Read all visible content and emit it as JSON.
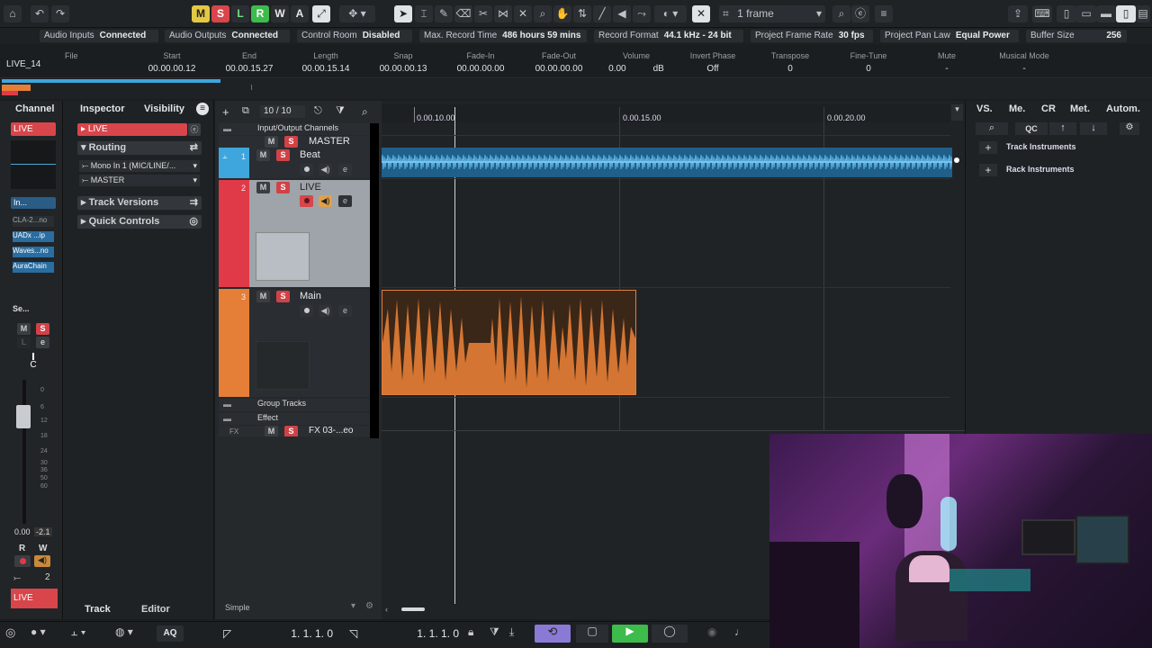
{
  "toolbar": {
    "m": "M",
    "s": "S",
    "l": "L",
    "r": "R",
    "w": "W",
    "a": "A",
    "grid_label": "1 frame"
  },
  "status": [
    {
      "label": "Audio Inputs",
      "value": "Connected"
    },
    {
      "label": "Audio Outputs",
      "value": "Connected"
    },
    {
      "label": "Control Room",
      "value": "Disabled"
    },
    {
      "label": "Max. Record Time",
      "value": "486 hours 59 mins"
    },
    {
      "label": "Record Format",
      "value": "44.1 kHz - 24 bit"
    },
    {
      "label": "Project Frame Rate",
      "value": "30 fps"
    },
    {
      "label": "Project Pan Law",
      "value": "Equal Power"
    },
    {
      "label": "Buffer Size",
      "value": "256"
    }
  ],
  "infoline": {
    "file_label": "File",
    "file": "LIVE_14",
    "start_label": "Start",
    "start": "00.00.00.12",
    "end_label": "End",
    "end": "00.00.15.27",
    "length_label": "Length",
    "length": "00.00.15.14",
    "snap_label": "Snap",
    "snap": "00.00.00.13",
    "fadein_label": "Fade-In",
    "fadein": "00.00.00.00",
    "fadeout_label": "Fade-Out",
    "fadeout": "00.00.00.00",
    "volume_label": "Volume",
    "volume": "0.00",
    "volume_unit": "dB",
    "invert_label": "Invert Phase",
    "invert": "Off",
    "transpose_label": "Transpose",
    "transpose": "0",
    "finetune_label": "Fine-Tune",
    "finetune": "0",
    "mute_label": "Mute",
    "mute": "-",
    "musical_label": "Musical Mode",
    "musical": "-"
  },
  "left": {
    "channel_tab": "Channel",
    "inspector_tab": "Inspector",
    "visibility_tab": "Visibility",
    "channel_name": "LIVE",
    "inserts_label": "In...",
    "inserts": [
      "CLA-2...no",
      "UADx ...ip",
      "Waves...no",
      "AuraChain"
    ],
    "sends_label": "Se...",
    "m": "M",
    "s": "S",
    "l": "L",
    "e": "e",
    "pan": "C",
    "fader_scale": [
      "0",
      "6",
      "12",
      "18",
      "24",
      "30",
      "36",
      "50",
      "60"
    ],
    "vol": "0.00",
    "peak": "-2.1",
    "r": "R",
    "w": "W",
    "group": "2",
    "bottom_name": "LIVE",
    "inspector_track": "LIVE",
    "routing": "Routing",
    "input": "Mono In 1 (MIC/LINE/...",
    "output": "MASTER",
    "track_versions": "Track Versions",
    "quick_controls": "Quick Controls",
    "track_tab": "Track",
    "editor_tab": "Editor"
  },
  "tracklist": {
    "count": "10 / 10",
    "folder_io": "Input/Output Channels",
    "master": "MASTER",
    "tracks": [
      {
        "num": "1",
        "name": "Beat",
        "color": "#3ea6dd"
      },
      {
        "num": "2",
        "name": "LIVE",
        "color": "#e03a48"
      },
      {
        "num": "3",
        "name": "Main",
        "color": "#e57e36"
      }
    ],
    "group_tracks": "Group Tracks",
    "effect": "Effect",
    "fx_name": "FX 03-...eo",
    "fx_short": "FX",
    "m": "M",
    "s": "S",
    "e": "e",
    "simple": "Simple"
  },
  "ruler": {
    "t1": "0.00.10.00",
    "t2": "0.00.15.00",
    "t3": "0.00.20.00"
  },
  "right": {
    "tabs": [
      "VS.",
      "Me.",
      "CR",
      "Met.",
      "Autom."
    ],
    "qc": "QC",
    "track_instruments": "Track Instruments",
    "rack_instruments": "Rack Instruments"
  },
  "transport": {
    "left_locator": "1. 1. 1.   0",
    "right_locator": "1. 1. 1.   0",
    "aq": "AQ"
  },
  "colors": {
    "beat": "#3ea6dd",
    "live": "#e03a48",
    "main": "#e57e36",
    "record": "#d8454a",
    "play": "#3dbb4b"
  }
}
